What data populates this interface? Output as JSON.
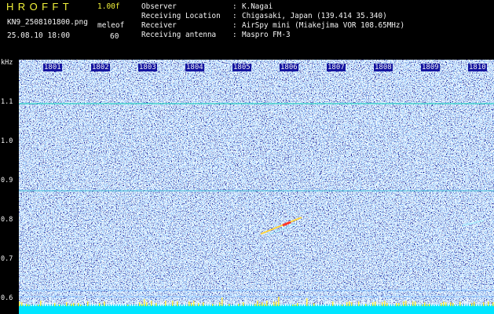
{
  "app": {
    "title": "HROFFT",
    "version": "1.00f",
    "filename": "KN9_2508101800.png",
    "mode": "meleof",
    "datetime": "25.08.10 18:00",
    "interval": "60"
  },
  "info": {
    "rows": [
      {
        "label": "Observer",
        "value": "K.Nagai"
      },
      {
        "label": "Receiving Location",
        "value": "Chigasaki, Japan (139.414 35.340)"
      },
      {
        "label": "Receiver",
        "value": "AirSpy mini (Miakejima VOR 108.65MHz)"
      },
      {
        "label": "Receiving antenna",
        "value": "Maspro FM-3"
      }
    ]
  },
  "axis": {
    "y_unit": "kHz",
    "y_ticks": [
      "1.1",
      "1.0",
      "0.9",
      "0.8",
      "0.7",
      "0.6"
    ],
    "x_ticks": [
      "1801",
      "1802",
      "1803",
      "1804",
      "1805",
      "1806",
      "1807",
      "1808",
      "1809",
      "1810"
    ]
  },
  "colors": {
    "background": "#000000",
    "title_yellow": "#f2f23a",
    "spectrogram_base": "#0a0a90",
    "cyan_bottom": "#00e5ff"
  }
}
